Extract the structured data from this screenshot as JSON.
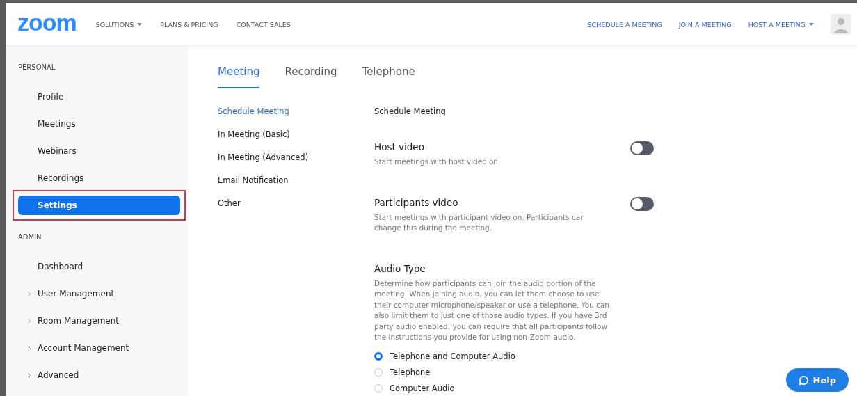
{
  "header": {
    "logo": "zoom",
    "nav_left": [
      {
        "label": "SOLUTIONS",
        "dropdown": true
      },
      {
        "label": "PLANS & PRICING",
        "dropdown": false
      },
      {
        "label": "CONTACT SALES",
        "dropdown": false
      }
    ],
    "nav_right": [
      {
        "label": "SCHEDULE A MEETING",
        "dropdown": false
      },
      {
        "label": "JOIN A MEETING",
        "dropdown": false
      },
      {
        "label": "HOST A MEETING",
        "dropdown": true
      }
    ]
  },
  "sidebar": {
    "sections": [
      {
        "title": "PERSONAL",
        "items": [
          {
            "label": "Profile",
            "selected": false,
            "expandable": false,
            "annotated": false
          },
          {
            "label": "Meetings",
            "selected": false,
            "expandable": false,
            "annotated": false
          },
          {
            "label": "Webinars",
            "selected": false,
            "expandable": false,
            "annotated": false
          },
          {
            "label": "Recordings",
            "selected": false,
            "expandable": false,
            "annotated": false
          },
          {
            "label": "Settings",
            "selected": true,
            "expandable": false,
            "annotated": true
          }
        ]
      },
      {
        "title": "ADMIN",
        "items": [
          {
            "label": "Dashboard",
            "selected": false,
            "expandable": false,
            "annotated": false
          },
          {
            "label": "User Management",
            "selected": false,
            "expandable": true,
            "annotated": false
          },
          {
            "label": "Room Management",
            "selected": false,
            "expandable": true,
            "annotated": false
          },
          {
            "label": "Account Management",
            "selected": false,
            "expandable": true,
            "annotated": false
          },
          {
            "label": "Advanced",
            "selected": false,
            "expandable": true,
            "annotated": false
          }
        ]
      }
    ]
  },
  "tabs": [
    {
      "label": "Meeting",
      "selected": true
    },
    {
      "label": "Recording",
      "selected": false
    },
    {
      "label": "Telephone",
      "selected": false
    }
  ],
  "subnav": [
    {
      "label": "Schedule Meeting",
      "selected": true
    },
    {
      "label": "In Meeting (Basic)",
      "selected": false
    },
    {
      "label": "In Meeting (Advanced)",
      "selected": false
    },
    {
      "label": "Email Notification",
      "selected": false
    },
    {
      "label": "Other",
      "selected": false
    }
  ],
  "section_title": "Schedule Meeting",
  "settings": [
    {
      "kind": "toggle",
      "title": "Host video",
      "description": "Start meetings with host video on",
      "on": false
    },
    {
      "kind": "toggle",
      "title": "Participants video",
      "description": "Start meetings with participant video on. Participants can change this during the meeting.",
      "on": false
    },
    {
      "kind": "radio",
      "title": "Audio Type",
      "description": "Determine how participants can join the audio portion of the meeting. When joining audio, you can let them choose to use their computer microphone/speaker or use a telephone. You can also limit them to just one of those audio types. If you have 3rd party audio enabled, you can require that all participants follow the instructions you provide for using non-Zoom audio.",
      "options": [
        {
          "label": "Telephone and Computer Audio",
          "selected": true
        },
        {
          "label": "Telephone",
          "selected": false
        },
        {
          "label": "Computer Audio",
          "selected": false
        }
      ]
    }
  ],
  "help_button": "Help"
}
